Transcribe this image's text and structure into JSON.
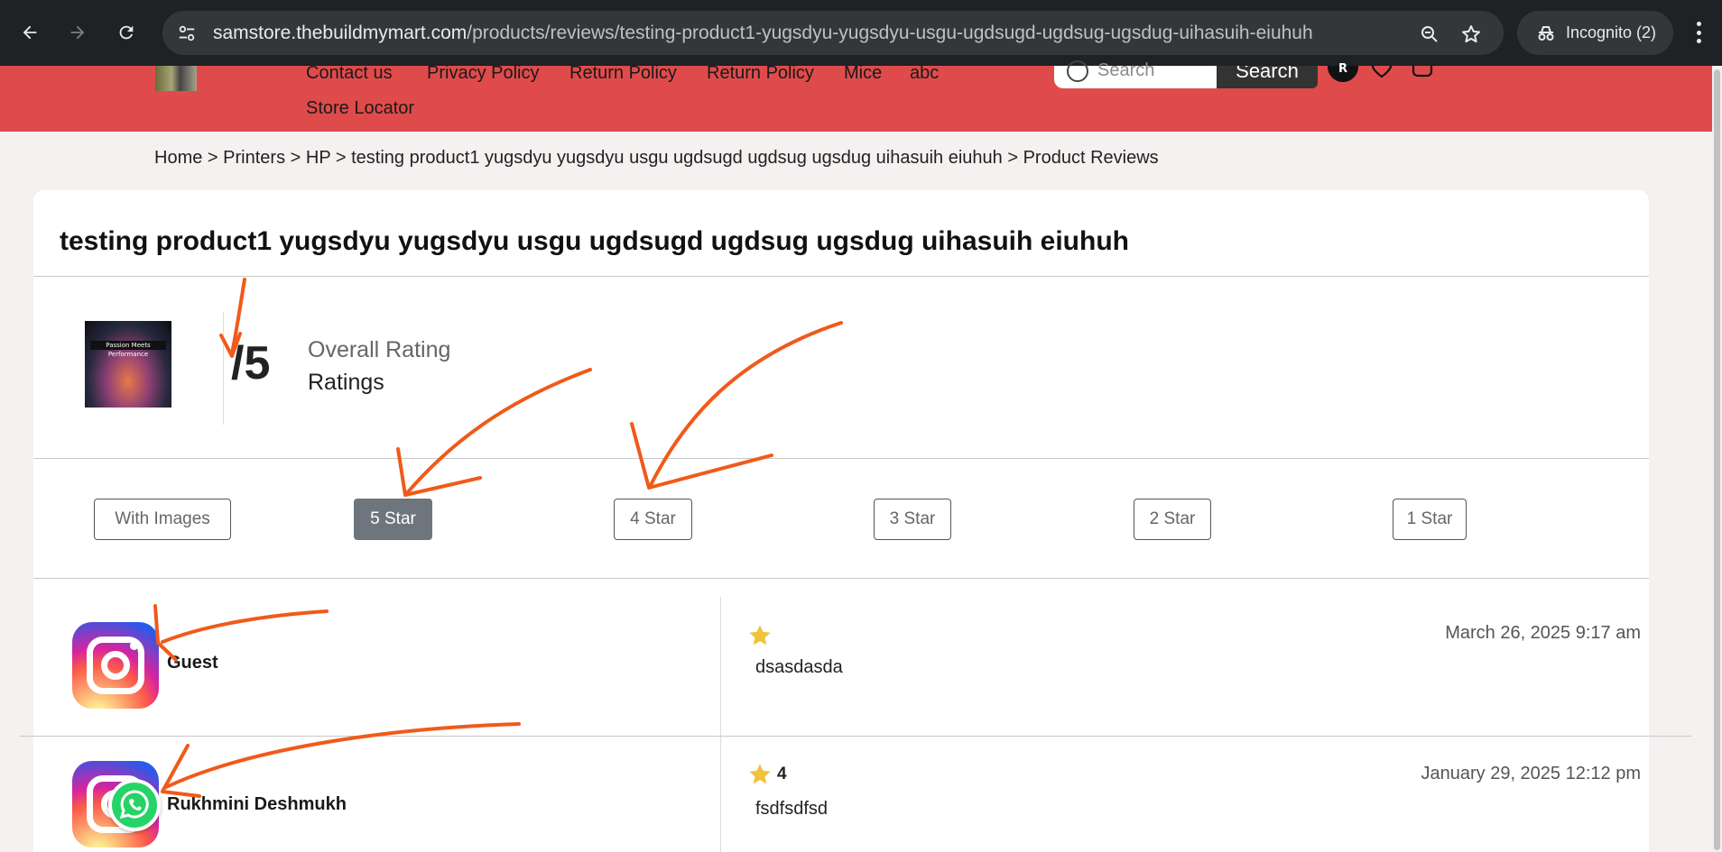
{
  "browser": {
    "url_host": "samstore.thebuildmymart.com",
    "url_path": "/products/reviews/testing-product1-yugsdyu-yugsdyu-usgu-ugdsugd-ugdsug-ugsdug-uihasuih-eiuhuh",
    "incognito_label": "Incognito (2)"
  },
  "header": {
    "nav": [
      "Contact us",
      "Privacy Policy",
      "Return Policy",
      "Return Policy",
      "Mice",
      "abc",
      "Store Locator"
    ],
    "search_placeholder": "Search",
    "search_button": "Search",
    "account_initial": "R",
    "brand_color": "#df4b4b"
  },
  "breadcrumb": {
    "items": [
      "Home",
      "Printers",
      "HP",
      "testing product1 yugsdyu yugsdyu usgu ugdsugd ugdsug ugsdug uihasuih eiuhuh",
      "Product Reviews"
    ],
    "separator": ">"
  },
  "product": {
    "title": "testing product1 yugsdyu yugsdyu usgu ugdsugd ugdsug ugsdug uihasuih eiuhuh",
    "image_caption": "Passion Meets Performance",
    "score": "/5",
    "overall_label": "Overall Rating",
    "ratings_label": "Ratings"
  },
  "filters": {
    "items": [
      "With Images",
      "5 Star",
      "4 Star",
      "3 Star",
      "2 Star",
      "1 Star"
    ],
    "active": "5 Star",
    "active_color": "#6e757c"
  },
  "reviews": [
    {
      "name": "Guest",
      "rating": "",
      "date": "March 26, 2025 9:17 am",
      "text": "dsasdasda"
    },
    {
      "name": "Rukhmini Deshmukh",
      "rating": "4",
      "date": "January 29, 2025 12:12 pm",
      "text": "fsdfsdfsd"
    }
  ],
  "icons": {
    "back": "arrow-left-icon",
    "forward": "arrow-right-icon",
    "reload": "reload-icon",
    "site_info": "tune-icon",
    "zoom": "zoom-icon",
    "bookmark": "star-outline-icon",
    "incognito": "incognito-icon",
    "menu": "kebab-menu-icon",
    "wishlist": "heart-icon",
    "cart": "bag-icon",
    "star": "star-icon",
    "avatar": "instagram-icon",
    "chat": "whatsapp-icon"
  },
  "annotation_color": "#f05a1a"
}
